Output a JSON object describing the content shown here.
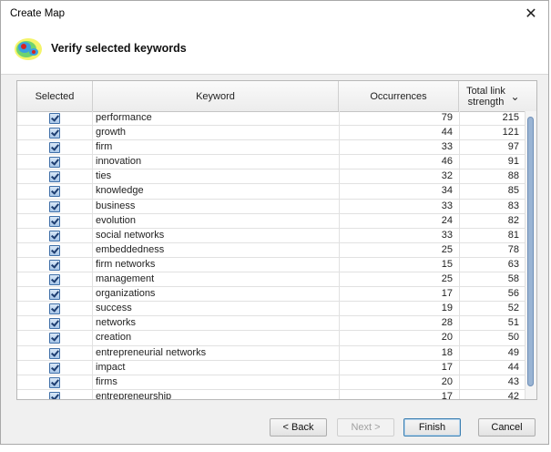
{
  "window": {
    "title": "Create Map"
  },
  "header": {
    "heading": "Verify selected keywords",
    "logo_icon": "heatmap-icon"
  },
  "table": {
    "columns": [
      "Selected",
      "Keyword",
      "Occurrences",
      "Total link strength"
    ],
    "sorted_column": "Total link strength",
    "rows": [
      {
        "keyword": "performance",
        "occurrences": "79",
        "strength": "215",
        "selected": true
      },
      {
        "keyword": "growth",
        "occurrences": "44",
        "strength": "121",
        "selected": true
      },
      {
        "keyword": "firm",
        "occurrences": "33",
        "strength": "97",
        "selected": true
      },
      {
        "keyword": "innovation",
        "occurrences": "46",
        "strength": "91",
        "selected": true
      },
      {
        "keyword": "ties",
        "occurrences": "32",
        "strength": "88",
        "selected": true
      },
      {
        "keyword": "knowledge",
        "occurrences": "34",
        "strength": "85",
        "selected": true
      },
      {
        "keyword": "business",
        "occurrences": "33",
        "strength": "83",
        "selected": true
      },
      {
        "keyword": "evolution",
        "occurrences": "24",
        "strength": "82",
        "selected": true
      },
      {
        "keyword": "social networks",
        "occurrences": "33",
        "strength": "81",
        "selected": true
      },
      {
        "keyword": "embeddedness",
        "occurrences": "25",
        "strength": "78",
        "selected": true
      },
      {
        "keyword": "firm networks",
        "occurrences": "15",
        "strength": "63",
        "selected": true
      },
      {
        "keyword": "management",
        "occurrences": "25",
        "strength": "58",
        "selected": true
      },
      {
        "keyword": "organizations",
        "occurrences": "17",
        "strength": "56",
        "selected": true
      },
      {
        "keyword": "success",
        "occurrences": "19",
        "strength": "52",
        "selected": true
      },
      {
        "keyword": "networks",
        "occurrences": "28",
        "strength": "51",
        "selected": true
      },
      {
        "keyword": "creation",
        "occurrences": "20",
        "strength": "50",
        "selected": true
      },
      {
        "keyword": "entrepreneurial networks",
        "occurrences": "18",
        "strength": "49",
        "selected": true
      },
      {
        "keyword": "impact",
        "occurrences": "17",
        "strength": "44",
        "selected": true
      },
      {
        "keyword": "firms",
        "occurrences": "20",
        "strength": "43",
        "selected": true
      },
      {
        "keyword": "entrepreneurship",
        "occurrences": "17",
        "strength": "42",
        "selected": true
      }
    ]
  },
  "buttons": {
    "back": "< Back",
    "next": "Next >",
    "finish": "Finish",
    "cancel": "Cancel"
  },
  "colors": {
    "accent": "#3c7fb1",
    "checkbox": "#a8c6e8",
    "scroll_thumb": "#9ab4d3"
  }
}
